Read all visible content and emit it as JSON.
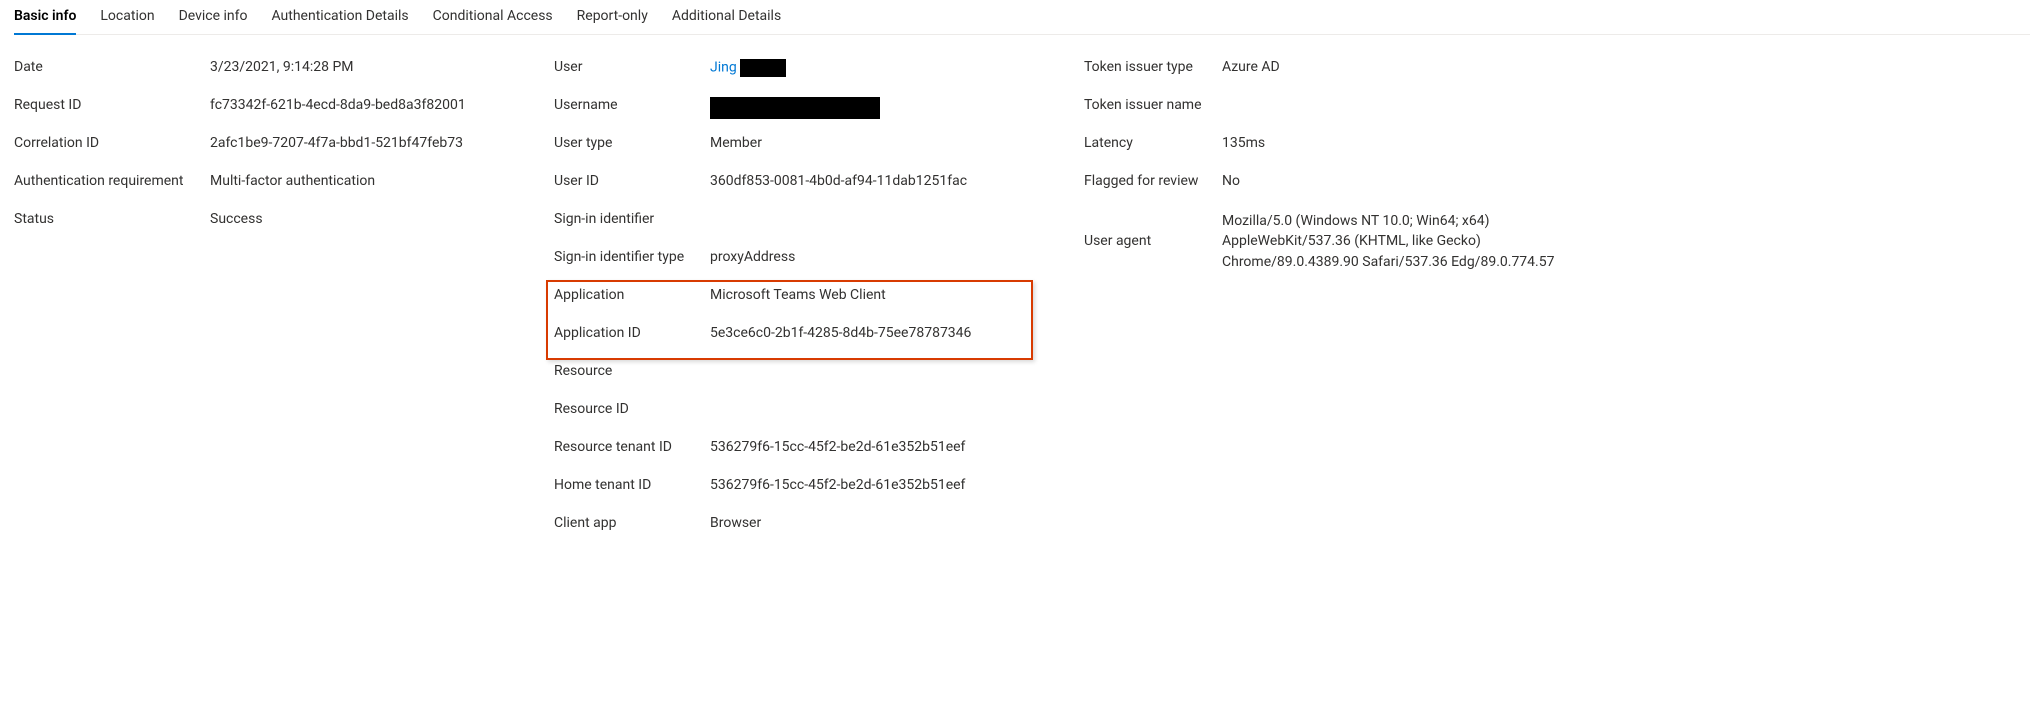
{
  "tabs": {
    "basic_info": "Basic info",
    "location": "Location",
    "device_info": "Device info",
    "authentication_details": "Authentication Details",
    "conditional_access": "Conditional Access",
    "report_only": "Report-only",
    "additional_details": "Additional Details"
  },
  "col1": {
    "date_label": "Date",
    "date_value": "3/23/2021, 9:14:28 PM",
    "request_id_label": "Request ID",
    "request_id_value": "fc73342f-621b-4ecd-8da9-bed8a3f82001",
    "correlation_id_label": "Correlation ID",
    "correlation_id_value": "2afc1be9-7207-4f7a-bbd1-521bf47feb73",
    "auth_req_label": "Authentication requirement",
    "auth_req_value": "Multi-factor authentication",
    "status_label": "Status",
    "status_value": "Success"
  },
  "col2": {
    "user_label": "User",
    "user_value_link": "Jing",
    "username_label": "Username",
    "username_value": "",
    "user_type_label": "User type",
    "user_type_value": "Member",
    "user_id_label": "User ID",
    "user_id_value": "360df853-0081-4b0d-af94-11dab1251fac",
    "signin_identifier_label": "Sign-in identifier",
    "signin_identifier_value": "",
    "signin_identifier_type_label": "Sign-in identifier type",
    "signin_identifier_type_value": "proxyAddress",
    "application_label": "Application",
    "application_value": "Microsoft Teams Web Client",
    "application_id_label": "Application ID",
    "application_id_value": "5e3ce6c0-2b1f-4285-8d4b-75ee78787346",
    "resource_label": "Resource",
    "resource_value": "",
    "resource_id_label": "Resource ID",
    "resource_id_value": "",
    "resource_tenant_id_label": "Resource tenant ID",
    "resource_tenant_id_value": "536279f6-15cc-45f2-be2d-61e352b51eef",
    "home_tenant_id_label": "Home tenant ID",
    "home_tenant_id_value": "536279f6-15cc-45f2-be2d-61e352b51eef",
    "client_app_label": "Client app",
    "client_app_value": "Browser"
  },
  "col3": {
    "token_issuer_type_label": "Token issuer type",
    "token_issuer_type_value": "Azure AD",
    "token_issuer_name_label": "Token issuer name",
    "token_issuer_name_value": "",
    "latency_label": "Latency",
    "latency_value": "135ms",
    "flagged_for_review_label": "Flagged for review",
    "flagged_for_review_value": "No",
    "user_agent_label": "User agent",
    "user_agent_line1": "Mozilla/5.0 (Windows NT 10.0; Win64; x64)",
    "user_agent_line2": "AppleWebKit/537.36 (KHTML, like Gecko)",
    "user_agent_line3": "Chrome/89.0.4389.90 Safari/537.36 Edg/89.0.774.57"
  }
}
